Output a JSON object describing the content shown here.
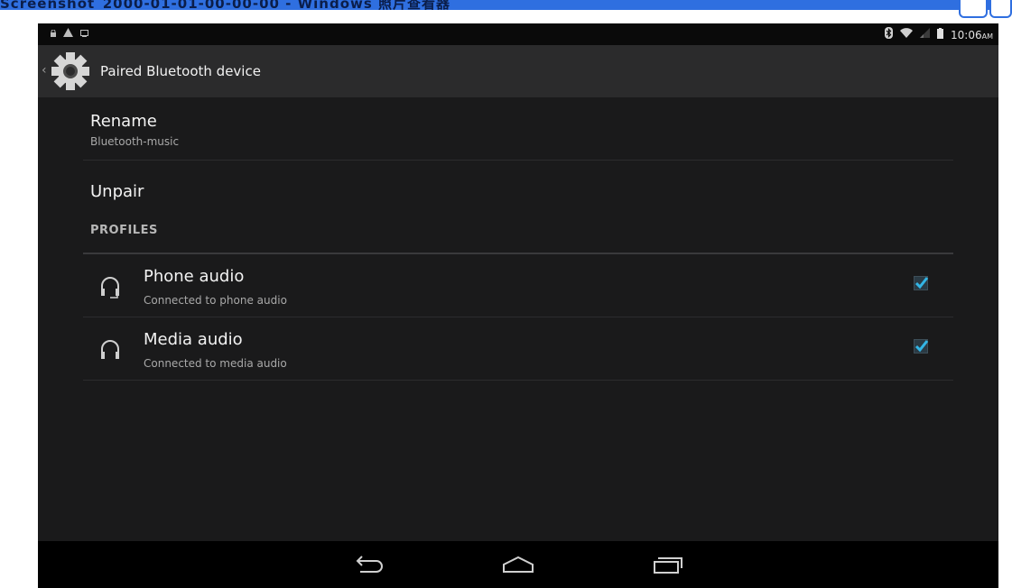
{
  "host": {
    "title": "Screenshot_2000-01-01-00-00-00 - Windows 照片查看器"
  },
  "statusbar": {
    "time": "10:06",
    "ampm": "AM",
    "left_icons": [
      "notification-lock-icon",
      "warning-icon",
      "screenshot-icon"
    ],
    "right_icons": [
      "bluetooth-icon",
      "wifi-icon",
      "signal-icon",
      "battery-icon"
    ]
  },
  "actionbar": {
    "title": "Paired Bluetooth device",
    "icon": "settings-gear-icon"
  },
  "list": {
    "rename": {
      "title": "Rename",
      "summary": "Bluetooth-music"
    },
    "unpair": {
      "title": "Unpair"
    },
    "category": "PROFILES",
    "profiles": [
      {
        "title": "Phone audio",
        "summary": "Connected to phone audio",
        "checked": true,
        "icon": "headset-mic-icon"
      },
      {
        "title": "Media audio",
        "summary": "Connected to media audio",
        "checked": true,
        "icon": "headphones-icon"
      }
    ]
  },
  "navbar": {
    "buttons": [
      "back-icon",
      "home-icon",
      "recents-icon"
    ]
  },
  "colors": {
    "accent": "#33b5e5",
    "background": "#1a1a1b",
    "actionbar": "#2b2b2c"
  }
}
